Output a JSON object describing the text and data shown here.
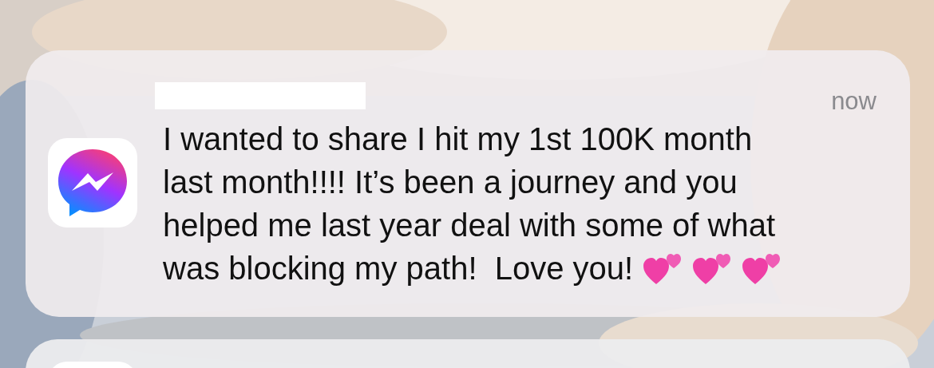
{
  "notifications": [
    {
      "kind": "full",
      "sender": {
        "redacted": true
      },
      "time": "now",
      "message": {
        "lines": [
          "I wanted to share I hit my 1st 100K month",
          "last month!!!! It’s been a journey and you",
          "helped me last year deal with some of what",
          "was blocking my path!  Love you!"
        ],
        "emojis": [
          {
            "kind": "two-hearts"
          },
          {
            "kind": "two-hearts"
          },
          {
            "kind": "two-hearts"
          }
        ]
      }
    },
    {
      "kind": "peek"
    }
  ]
}
